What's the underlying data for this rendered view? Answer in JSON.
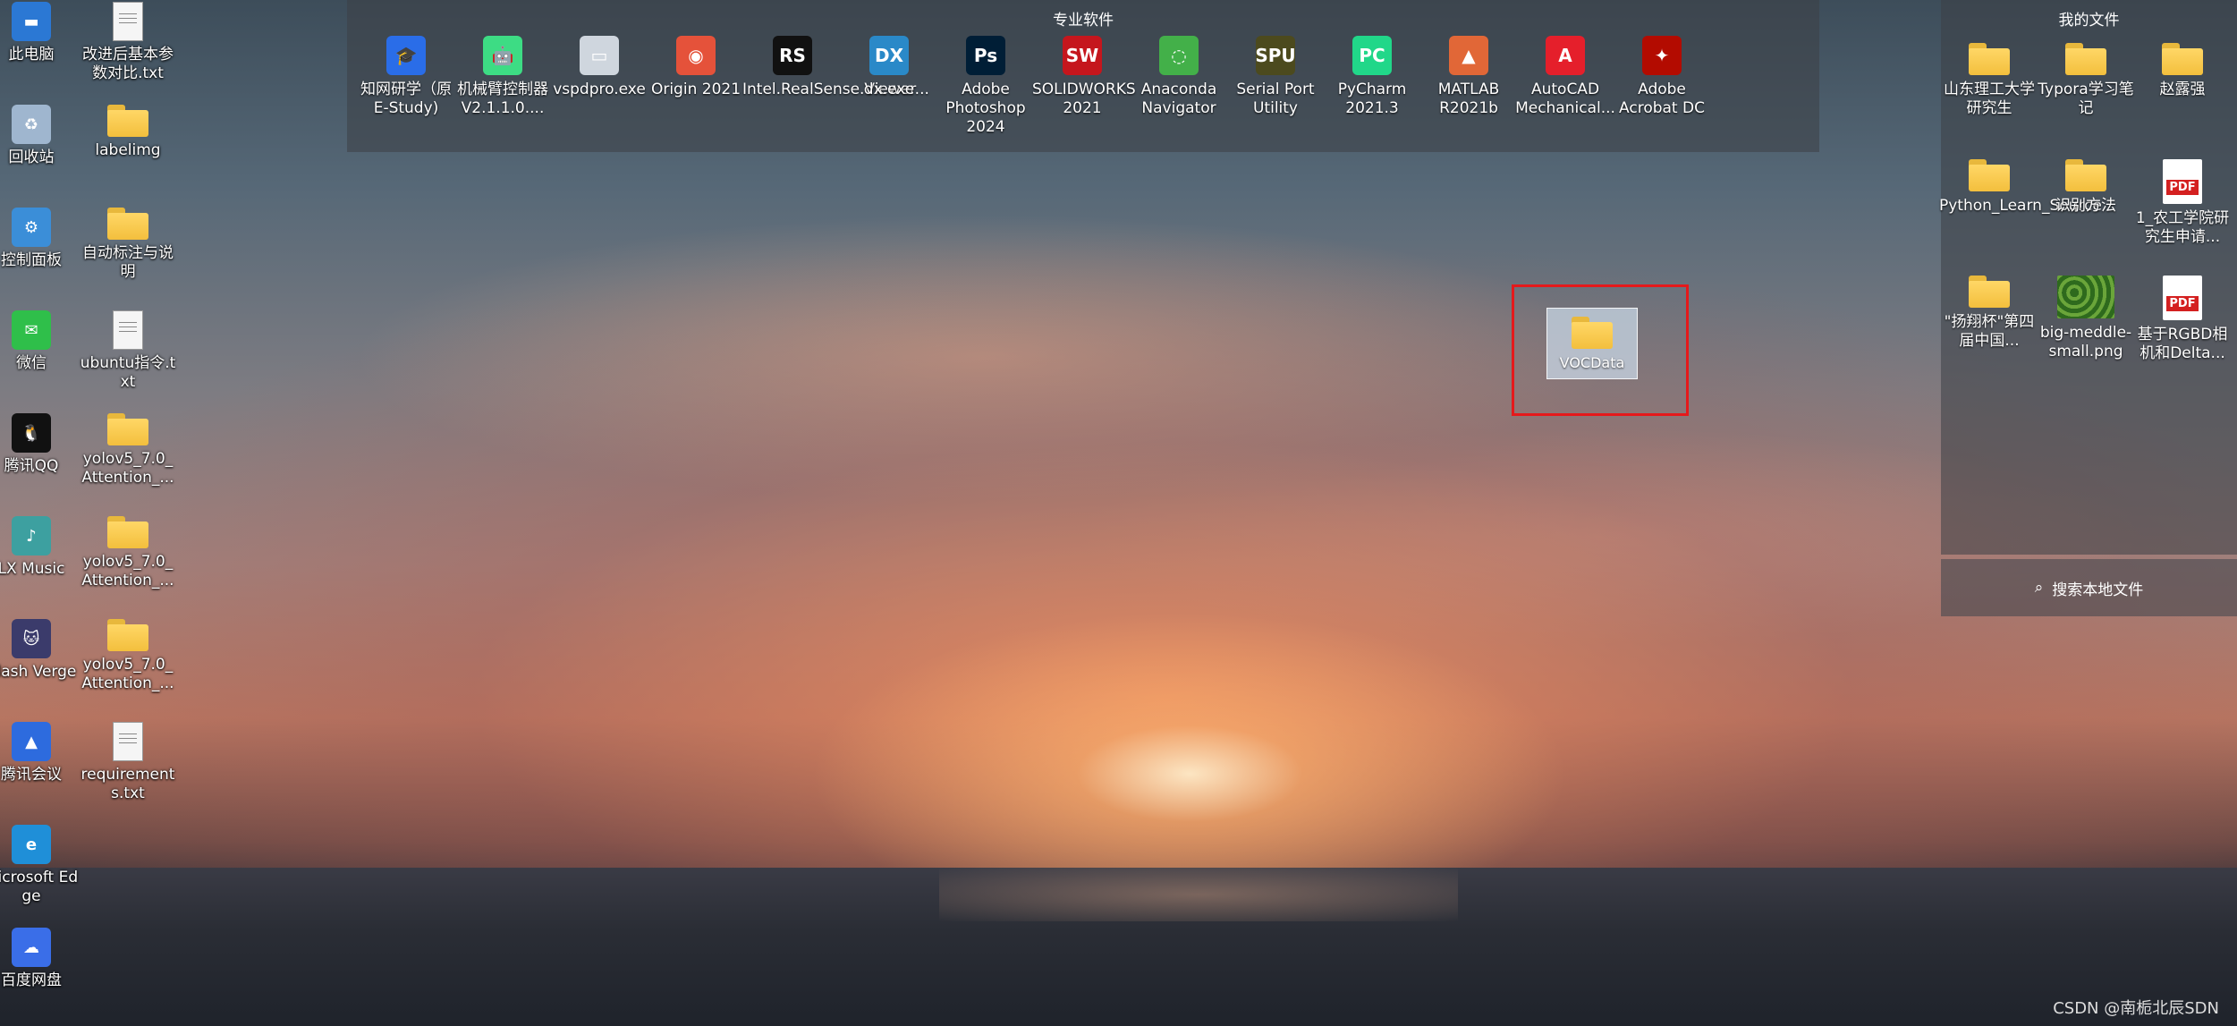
{
  "desktop_col1": [
    {
      "label": "此电脑",
      "icon": "monitor-icon"
    },
    {
      "label": "回收站",
      "icon": "recycle-bin-icon"
    },
    {
      "label": "控制面板",
      "icon": "control-panel-icon"
    },
    {
      "label": "微信",
      "icon": "wechat-icon"
    },
    {
      "label": "腾讯QQ",
      "icon": "qq-penguin-icon"
    },
    {
      "label": "LX Music",
      "icon": "lx-music-icon"
    },
    {
      "label": "Clash Verge",
      "icon": "clash-cat-icon"
    },
    {
      "label": "腾讯会议",
      "icon": "tencent-meeting-icon"
    },
    {
      "label": "Microsoft Edge",
      "icon": "edge-icon"
    },
    {
      "label": "百度网盘",
      "icon": "baidu-netdisk-icon"
    }
  ],
  "desktop_col2": [
    {
      "label": "改进后基本参数对比.txt",
      "icon": "text-file-icon"
    },
    {
      "label": "labelimg",
      "icon": "folder-icon"
    },
    {
      "label": "自动标注与说明",
      "icon": "folder-icon"
    },
    {
      "label": "ubuntu指令.txt",
      "icon": "text-file-icon"
    },
    {
      "label": "yolov5_7.0_Attention_...",
      "icon": "folder-icon"
    },
    {
      "label": "yolov5_7.0_Attention_...",
      "icon": "folder-icon"
    },
    {
      "label": "yolov5_7.0_Attention_...",
      "icon": "folder-icon"
    },
    {
      "label": "requirements.txt",
      "icon": "text-file-icon"
    }
  ],
  "pro_group": {
    "title": "专业软件",
    "items": [
      {
        "label": "知网研学（原E-Study)",
        "icon": "cnki-icon",
        "mark": "🎓",
        "color": "#2a6de8"
      },
      {
        "label": "机械臂控制器V2.1.1.0....",
        "icon": "android-icon",
        "mark": "🤖",
        "color": "#3ddc84"
      },
      {
        "label": "vspdpro.exe",
        "icon": "printer-icon",
        "mark": "▭",
        "color": "#cfd6de"
      },
      {
        "label": "Origin 2021",
        "icon": "origin-icon",
        "mark": "◉",
        "color": "#e5523a"
      },
      {
        "label": "Intel.RealSense.Viewer...",
        "icon": "realsense-icon",
        "mark": "RS",
        "color": "#111111"
      },
      {
        "label": "dx.exe",
        "icon": "dx-icon",
        "mark": "DX",
        "color": "#2a89c8"
      },
      {
        "label": "Adobe Photoshop 2024",
        "icon": "photoshop-icon",
        "mark": "Ps",
        "color": "#001e36"
      },
      {
        "label": "SOLIDWORKS 2021",
        "icon": "solidworks-icon",
        "mark": "SW",
        "color": "#c5161d"
      },
      {
        "label": "Anaconda Navigator",
        "icon": "anaconda-icon",
        "mark": "◌",
        "color": "#43b049"
      },
      {
        "label": "Serial Port Utility",
        "icon": "serial-port-icon",
        "mark": "SPU",
        "color": "#4c4a1e"
      },
      {
        "label": "PyCharm 2021.3",
        "icon": "pycharm-icon",
        "mark": "PC",
        "color": "#21d789"
      },
      {
        "label": "MATLAB R2021b",
        "icon": "matlab-icon",
        "mark": "▲",
        "color": "#e16737"
      },
      {
        "label": "AutoCAD Mechanical...",
        "icon": "autocad-icon",
        "mark": "A",
        "color": "#e51f2b"
      },
      {
        "label": "Adobe Acrobat DC",
        "icon": "acrobat-icon",
        "mark": "✦",
        "color": "#b30b00"
      }
    ]
  },
  "files_group": {
    "title": "我的文件",
    "items": [
      {
        "label": "山东理工大学研究生",
        "icon": "folder-icon",
        "kind": "folder"
      },
      {
        "label": "Typora学习笔记",
        "icon": "folder-icon",
        "kind": "folder"
      },
      {
        "label": "赵露强",
        "icon": "folder-icon",
        "kind": "folder"
      },
      {
        "label": "Python_Learn_Source",
        "icon": "folder-icon",
        "kind": "folder"
      },
      {
        "label": "识别方法",
        "icon": "folder-icon",
        "kind": "folder"
      },
      {
        "label": "1_农工学院研究生申请...",
        "icon": "pdf-icon",
        "kind": "pdf"
      },
      {
        "label": "\"扬翔杯\"第四届中国...",
        "icon": "folder-icon",
        "kind": "folder"
      },
      {
        "label": "big-meddle-small.png",
        "icon": "image-file-icon",
        "kind": "image"
      },
      {
        "label": "基于RGBD相机和Delta...",
        "icon": "pdf-icon",
        "kind": "pdf"
      }
    ],
    "search_label": "搜索本地文件"
  },
  "selected_folder": {
    "label": "VOCData"
  },
  "pdf_badge": "PDF",
  "watermark": "CSDN @南栀北辰SDN"
}
